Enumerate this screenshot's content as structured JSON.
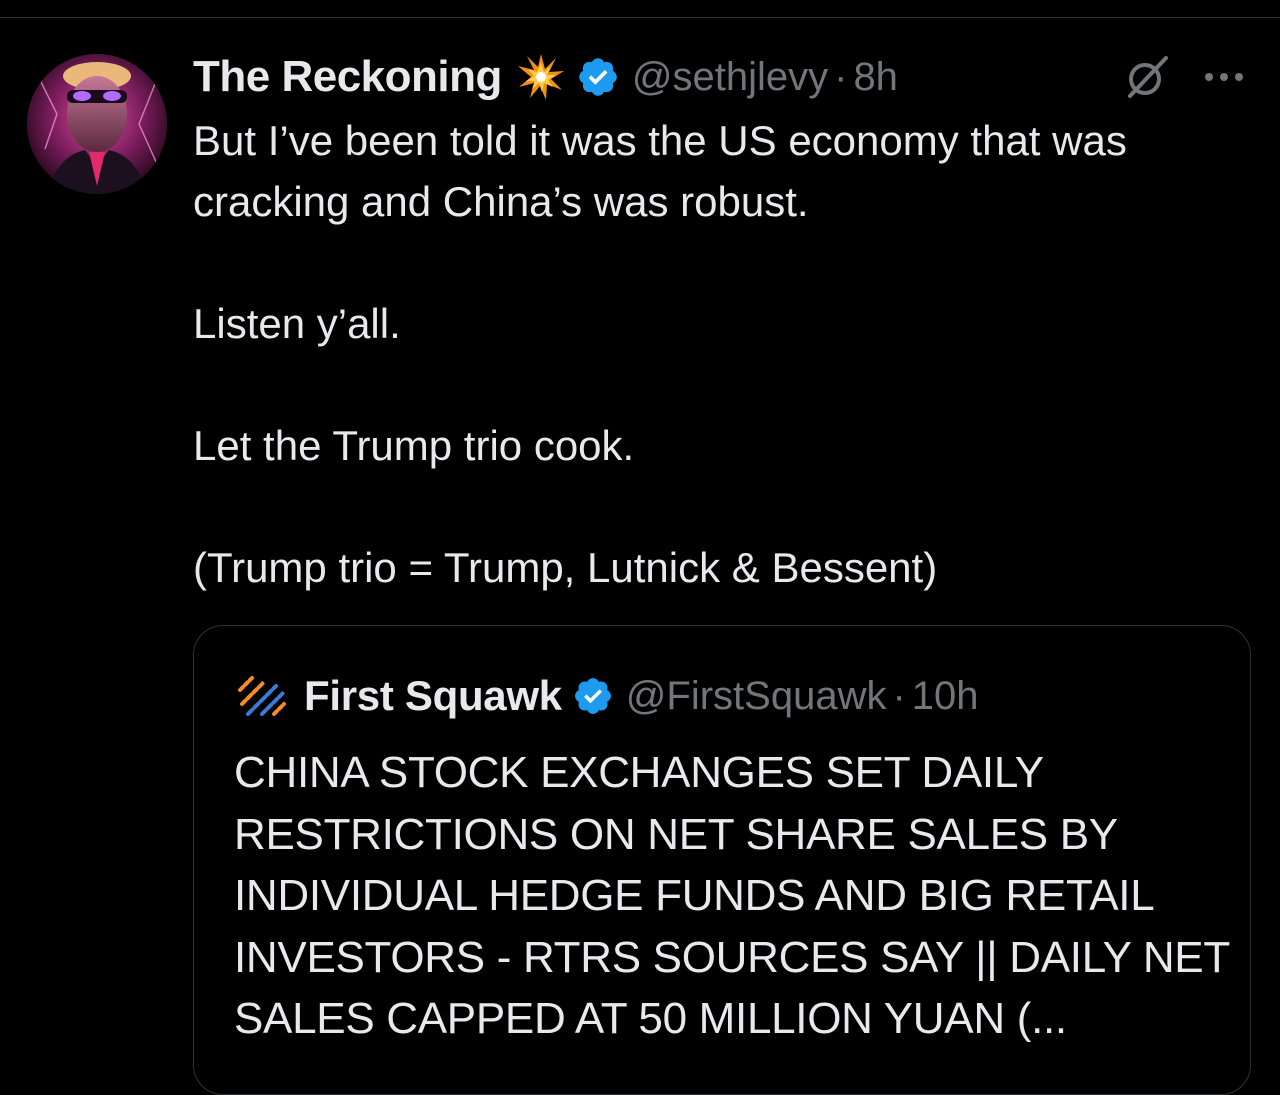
{
  "tweet": {
    "display_name": "The Reckoning",
    "name_emoji": "collision-emoji",
    "verified": true,
    "handle": "@sethjlevy",
    "separator": "·",
    "time": "8h",
    "paragraphs": [
      "But I’ve been told it was the US economy that was cracking and China’s was robust.",
      "Listen y’all.",
      "Let the Trump trio cook.",
      "(Trump trio = Trump, Lutnick & Bessent)"
    ],
    "icons": {
      "grok": "grok-icon",
      "more": "more-icon"
    }
  },
  "quoted_tweet": {
    "display_name": "First Squawk",
    "verified": true,
    "handle": "@FirstSquawk",
    "separator": "·",
    "time": "10h",
    "text": "CHINA STOCK EXCHANGES SET DAILY RESTRICTIONS ON NET SHARE SALES BY INDIVIDUAL HEDGE FUNDS AND BIG RETAIL INVESTORS - RTRS SOURCES SAY || DAILY NET SALES CAPPED AT 50 MILLION YUAN (..."
  },
  "colors": {
    "background": "#000000",
    "text": "#e7e9ea",
    "secondary": "#71767b",
    "border": "#2f3336",
    "verified": "#1d9bf0"
  }
}
